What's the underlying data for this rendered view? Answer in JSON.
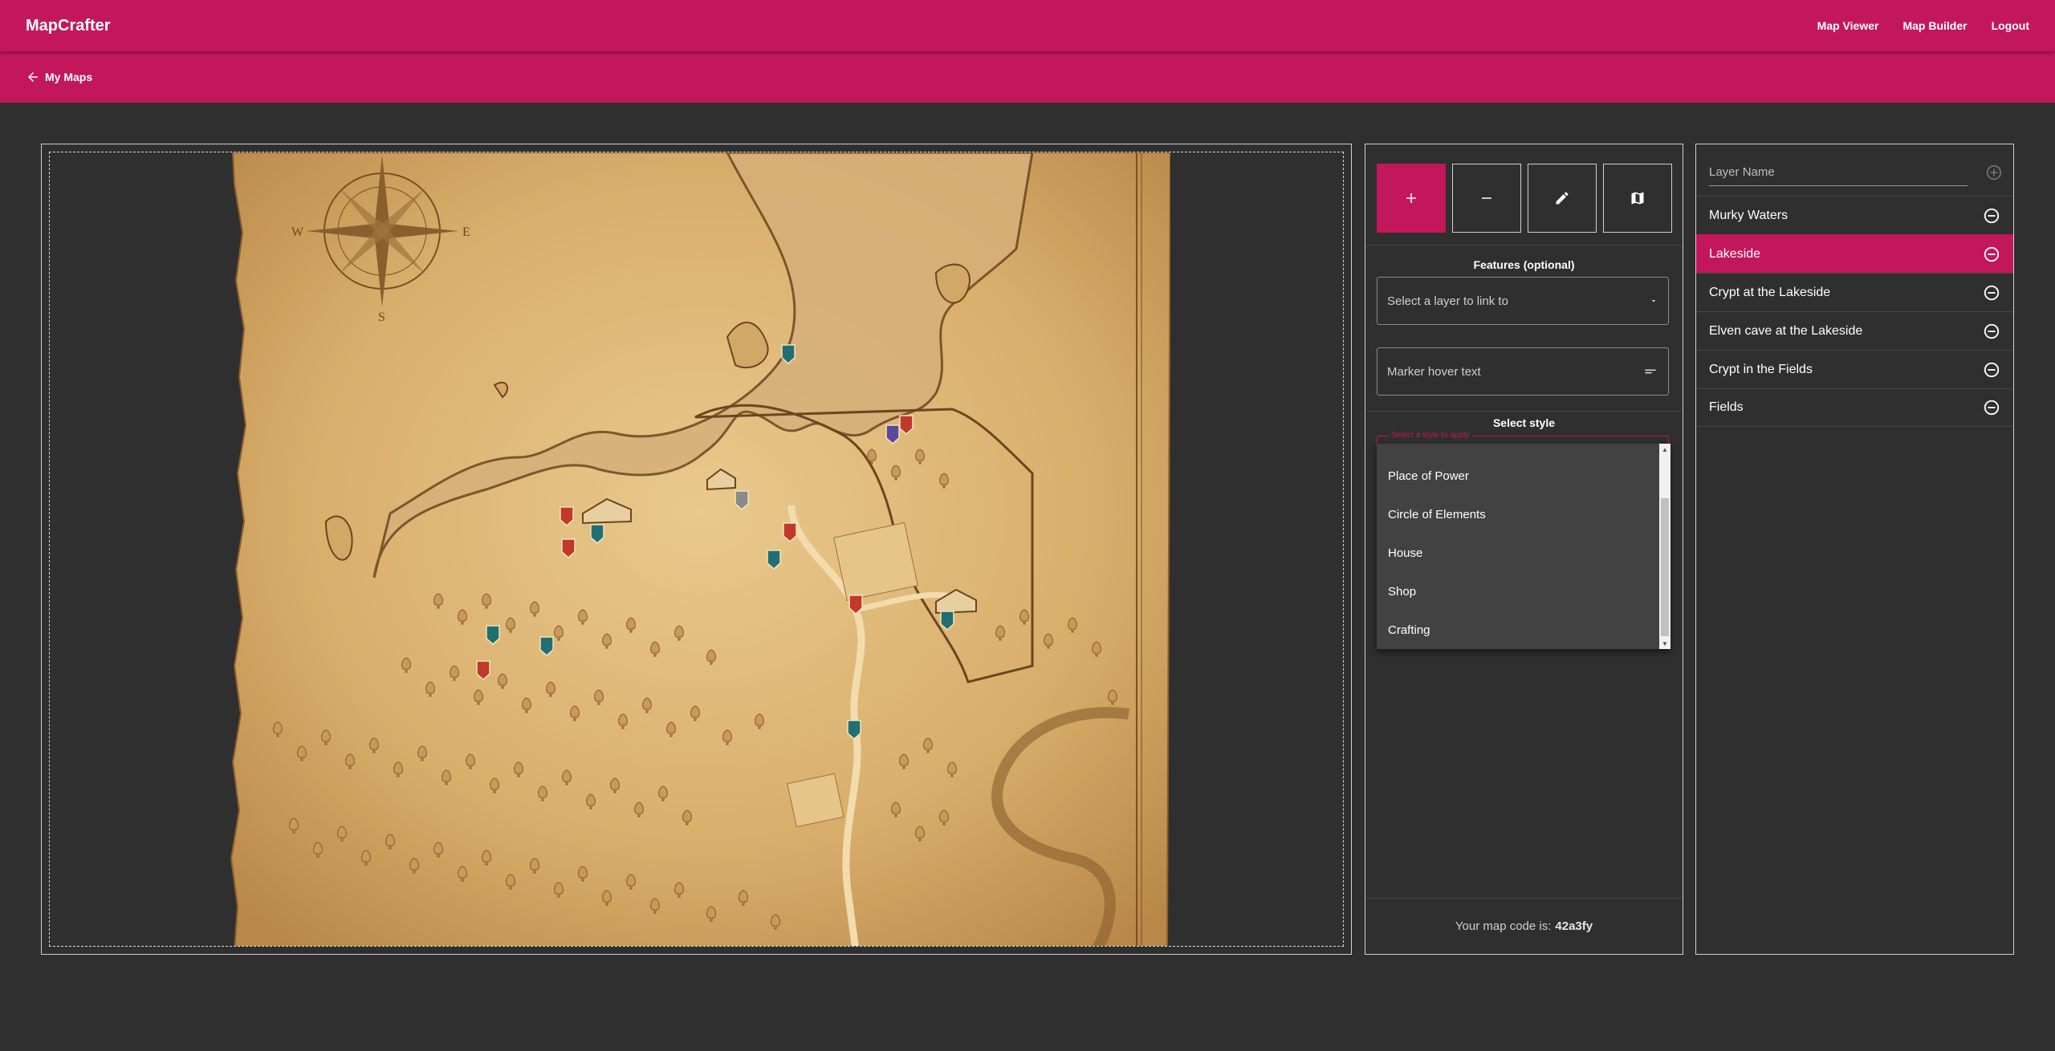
{
  "app": {
    "brand": "MapCrafter",
    "nav": [
      "Map Viewer",
      "Map Builder",
      "Logout"
    ],
    "back_label": "My Maps"
  },
  "tools": {
    "buttons": [
      "add-icon",
      "remove-icon",
      "pencil-icon",
      "map-icon"
    ],
    "active_index": 0,
    "features_label": "Features (optional)",
    "layer_select_placeholder": "Select a layer to link to",
    "hover_text_placeholder": "Marker hover text",
    "style_label": "Select style",
    "style_hint": "Select a style to apply",
    "style_options": [
      "Place of Power",
      "Circle of Elements",
      "House",
      "Shop",
      "Crafting"
    ],
    "map_code_prefix": "Your map code is:",
    "map_code": "42a3fy"
  },
  "layers": {
    "input_placeholder": "Layer Name",
    "items": [
      {
        "name": "Murky Waters",
        "active": false
      },
      {
        "name": "Lakeside",
        "active": true
      },
      {
        "name": "Crypt at the Lakeside",
        "active": false
      },
      {
        "name": "Elven cave at the Lakeside",
        "active": false
      },
      {
        "name": "Crypt in the Fields",
        "active": false
      },
      {
        "name": "Fields",
        "active": false
      }
    ]
  },
  "map": {
    "compass_letters": [
      "W",
      "E",
      "S"
    ],
    "marker_colors": {
      "fire": "#c0392b",
      "teal": "#1f6f73",
      "purple": "#5b4a9b",
      "grey": "#8a8a8a"
    }
  },
  "colors": {
    "accent": "#c2185b",
    "background": "#2f2f2f",
    "dropdown": "#424242"
  }
}
